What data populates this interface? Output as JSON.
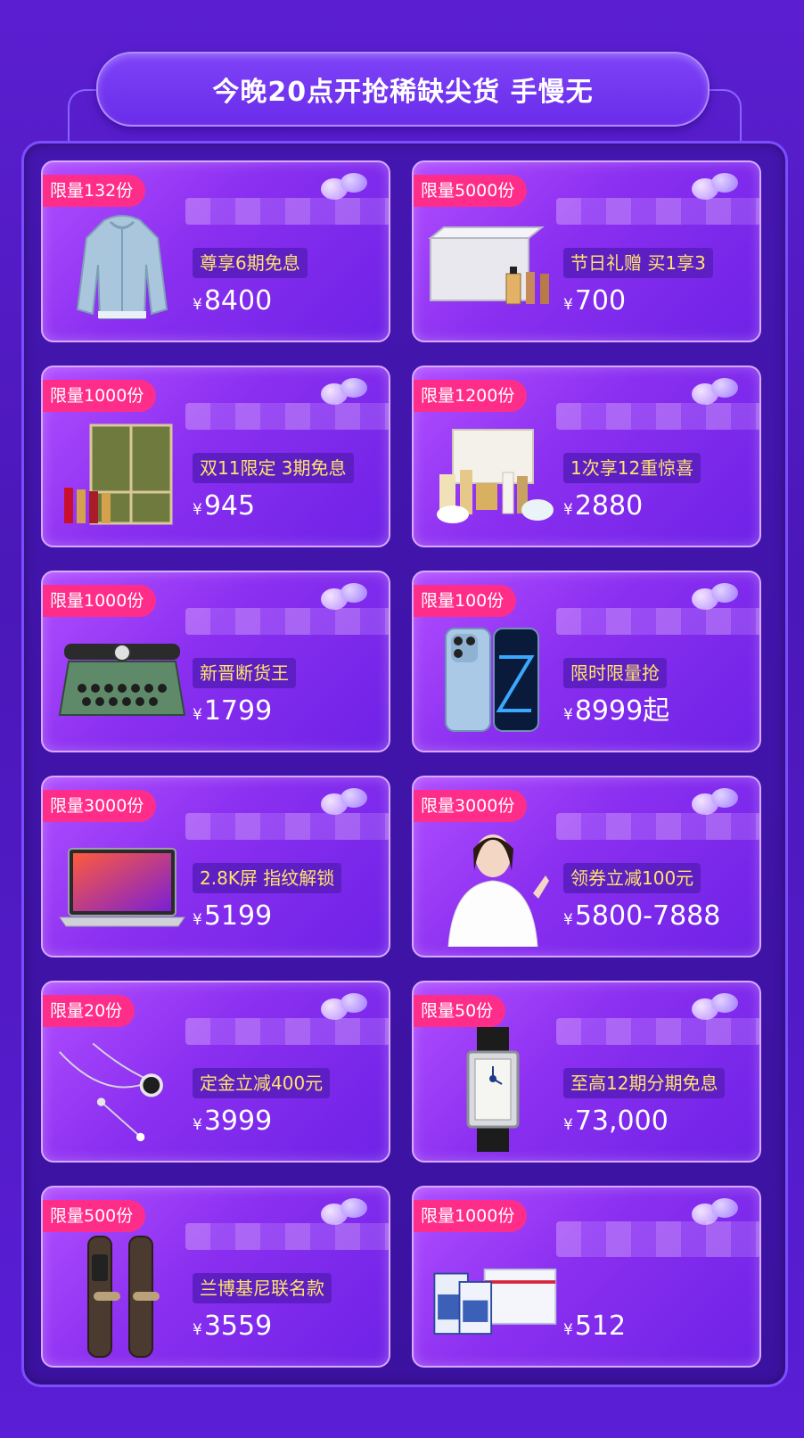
{
  "header": {
    "title": "今晚20点开抢稀缺尖货 手慢无"
  },
  "currency_symbol": "¥",
  "products": [
    {
      "limit": "限量132份",
      "tag": "尊享6期免息",
      "price": "8400",
      "icon": "jacket-icon"
    },
    {
      "limit": "限量5000份",
      "tag": "节日礼赠 买1享3",
      "price": "700",
      "icon": "perfume-gift-box-icon"
    },
    {
      "limit": "限量1000份",
      "tag": "双11限定 3期免息",
      "price": "945",
      "icon": "lipstick-gift-box-icon"
    },
    {
      "limit": "限量1200份",
      "tag": "1次享12重惊喜",
      "price": "2880",
      "icon": "skincare-set-icon"
    },
    {
      "limit": "限量1000份",
      "tag": "新晋断货王",
      "price": "1799",
      "icon": "typewriter-icon"
    },
    {
      "limit": "限量100份",
      "tag": "限时限量抢",
      "price": "8999起",
      "icon": "smartphone-icon"
    },
    {
      "limit": "限量3000份",
      "tag": "2.8K屏 指纹解锁",
      "price": "5199",
      "icon": "laptop-icon"
    },
    {
      "limit": "限量3000份",
      "tag": "领券立减100元",
      "price": "5800-7888",
      "icon": "person-icon"
    },
    {
      "limit": "限量20份",
      "tag": "定金立减400元",
      "price": "3999",
      "icon": "necklace-icon"
    },
    {
      "limit": "限量50份",
      "tag": "至高12期分期免息",
      "price": "73,000",
      "icon": "watch-icon"
    },
    {
      "limit": "限量500份",
      "tag": "兰博基尼联名款",
      "price": "3559",
      "icon": "smart-lock-icon"
    },
    {
      "limit": "限量1000份",
      "tag": "",
      "price": "512",
      "icon": "milk-box-icon"
    }
  ]
}
